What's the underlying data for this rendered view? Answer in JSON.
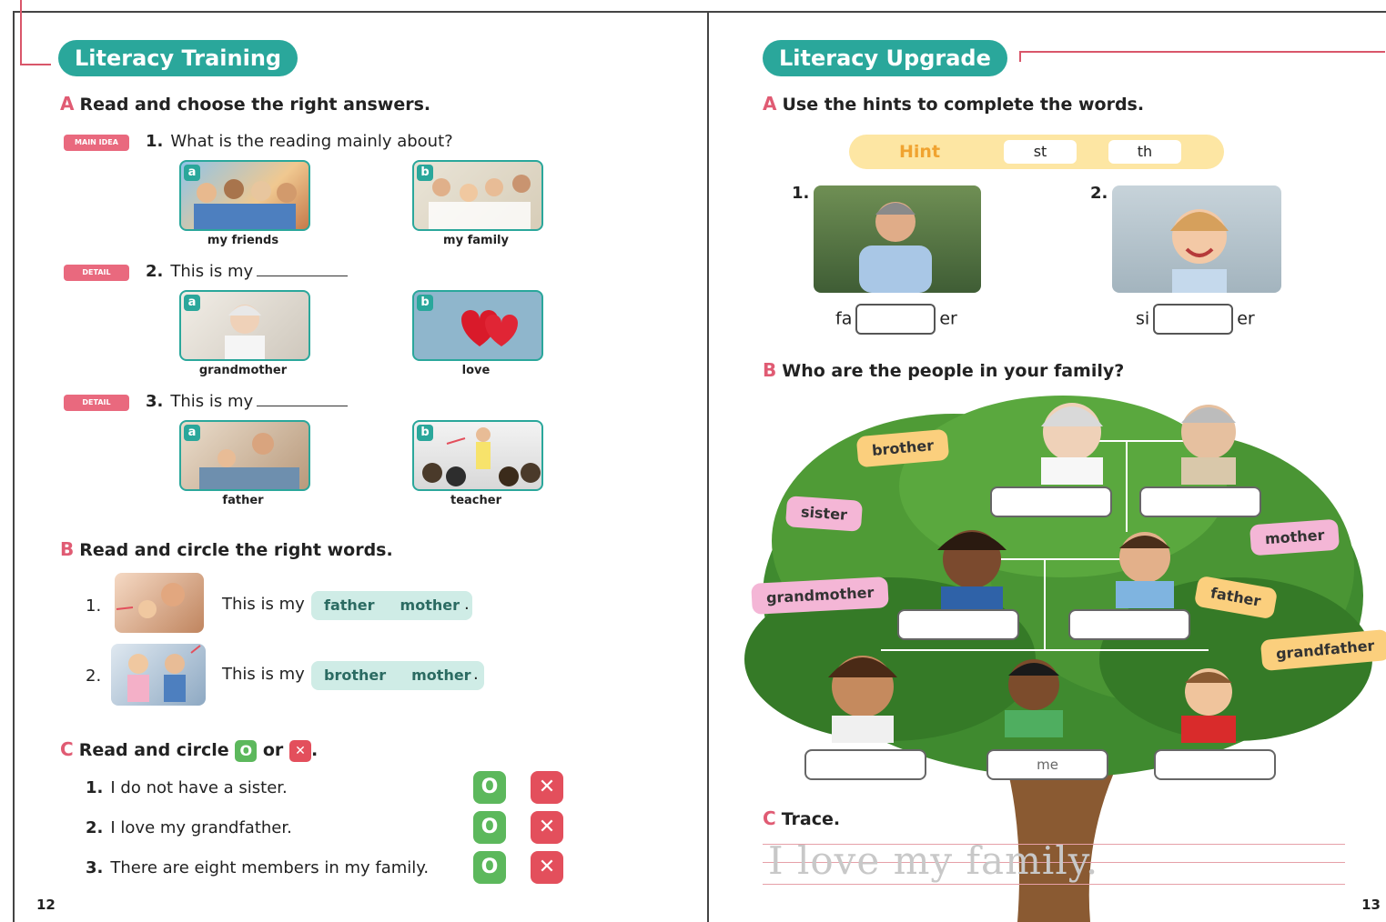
{
  "left": {
    "header": "Literacy Training",
    "A": {
      "letter": "A",
      "instruction": "Read and choose the right answers.",
      "questions": [
        {
          "tag": "MAIN IDEA",
          "num": "1.",
          "text": "What is the reading mainly about?",
          "options": [
            {
              "opt": "a",
              "caption": "my friends"
            },
            {
              "opt": "b",
              "caption": "my family"
            }
          ]
        },
        {
          "tag": "DETAIL",
          "num": "2.",
          "text": "This is my",
          "options": [
            {
              "opt": "a",
              "caption": "grandmother"
            },
            {
              "opt": "b",
              "caption": "love"
            }
          ]
        },
        {
          "tag": "DETAIL",
          "num": "3.",
          "text": "This is my",
          "options": [
            {
              "opt": "a",
              "caption": "father"
            },
            {
              "opt": "b",
              "caption": "teacher"
            }
          ]
        }
      ]
    },
    "B": {
      "letter": "B",
      "instruction": "Read and circle the right words.",
      "items": [
        {
          "num": "1.",
          "text": "This is my",
          "choices": [
            "father",
            "mother"
          ],
          "end": "."
        },
        {
          "num": "2.",
          "text": "This is my",
          "choices": [
            "brother",
            "mother"
          ],
          "end": "."
        }
      ]
    },
    "C": {
      "letter": "C",
      "instruction_a": "Read and circle",
      "instruction_or": "or",
      "instruction_end": ".",
      "o_symbol": "O",
      "x_symbol": "✕",
      "statements": [
        {
          "num": "1.",
          "text": "I do not have a sister."
        },
        {
          "num": "2.",
          "text": "I love my grandfather."
        },
        {
          "num": "3.",
          "text": "There are eight members in my family."
        }
      ]
    },
    "page_number": "12"
  },
  "right": {
    "header": "Literacy Upgrade",
    "A": {
      "letter": "A",
      "instruction": "Use the hints to complete the words.",
      "hint_label": "Hint",
      "hints": [
        "st",
        "th"
      ],
      "items": [
        {
          "num": "1.",
          "prefix": "fa",
          "suffix": "er"
        },
        {
          "num": "2.",
          "prefix": "si",
          "suffix": "er"
        }
      ]
    },
    "B": {
      "letter": "B",
      "instruction": "Who are the people in your family?",
      "labels": [
        "brother",
        "sister",
        "grandmother",
        "mother",
        "father",
        "grandfather"
      ],
      "me_label": "me"
    },
    "C": {
      "letter": "C",
      "instruction": "Trace.",
      "trace_text": "I love my family."
    },
    "page_number": "13"
  },
  "colors": {
    "teal": "#2aa79b",
    "pink_accent": "#e05b73",
    "hint_yellow": "#fde6a3",
    "choice_mint": "#cfece6",
    "o_green": "#5cb85c",
    "x_red": "#e34f5c"
  }
}
